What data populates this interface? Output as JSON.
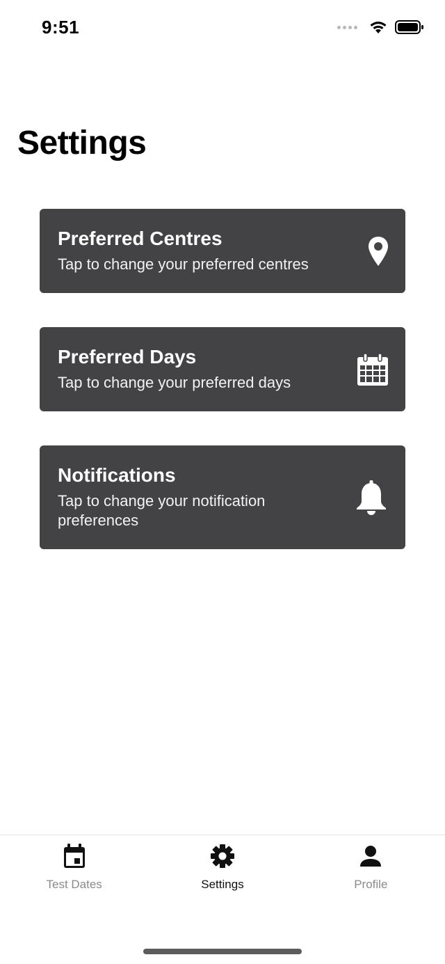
{
  "status_bar": {
    "time": "9:51"
  },
  "page": {
    "title": "Settings"
  },
  "cards": [
    {
      "title": "Preferred Centres",
      "subtitle": "Tap to change your preferred centres",
      "icon": "map-pin-icon"
    },
    {
      "title": "Preferred Days",
      "subtitle": "Tap to change your preferred days",
      "icon": "calendar-icon"
    },
    {
      "title": "Notifications",
      "subtitle": "Tap to change your notification preferences",
      "icon": "bell-icon"
    }
  ],
  "tab_bar": {
    "tabs": [
      {
        "label": "Test Dates",
        "icon": "calendar-event-icon",
        "active": false
      },
      {
        "label": "Settings",
        "icon": "gear-icon",
        "active": true
      },
      {
        "label": "Profile",
        "icon": "person-icon",
        "active": false
      }
    ]
  },
  "colors": {
    "card_background": "#434345",
    "active_tab": "#111111",
    "inactive_tab": "#8a8a8a"
  }
}
